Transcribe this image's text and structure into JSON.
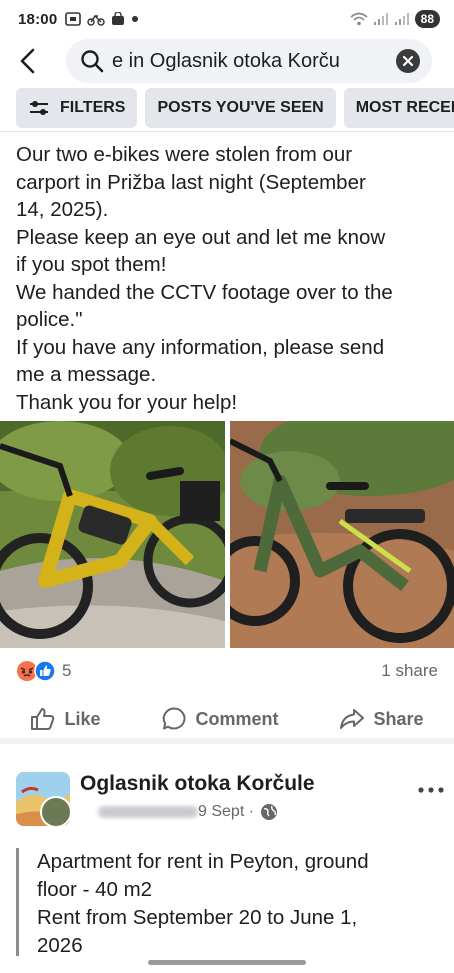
{
  "status_bar": {
    "time": "18:00",
    "battery": "88"
  },
  "search": {
    "query": "e in Oglasnik otoka Korču"
  },
  "filters": {
    "chips": [
      {
        "label": "FILTERS",
        "icon": "sliders-icon"
      },
      {
        "label": "POSTS YOU'VE SEEN"
      },
      {
        "label": "MOST RECEN"
      }
    ]
  },
  "post": {
    "text_lines": [
      "Our two e-bikes were stolen from our",
      "carport in Prižba last night (September",
      "14, 2025).",
      "Please keep an eye out and let me know",
      "if you spot them!",
      "We handed the CCTV footage over to the",
      "police.\"",
      "If you have any information, please send",
      "me a message.",
      "Thank you for your help!"
    ],
    "photos": [
      {
        "desc": "yellow-ebike"
      },
      {
        "desc": "green-ebike"
      }
    ],
    "reaction_count": "5",
    "share_count": "1 share",
    "actions": {
      "like": "Like",
      "comment": "Comment",
      "share": "Share"
    }
  },
  "next_post": {
    "group_name": "Oglasnik otoka Korčule",
    "date": "9 Sept ·",
    "text_lines": [
      "Apartment for rent in Peyton, ground",
      "floor - 40 m2",
      "Rent from September 20 to June 1,",
      "2026"
    ]
  },
  "colors": {
    "accent_blue": "#1877f2",
    "angry_orange": "#f7714c",
    "chip_bg": "#e4e6eb",
    "secondary_text": "#65676b"
  }
}
